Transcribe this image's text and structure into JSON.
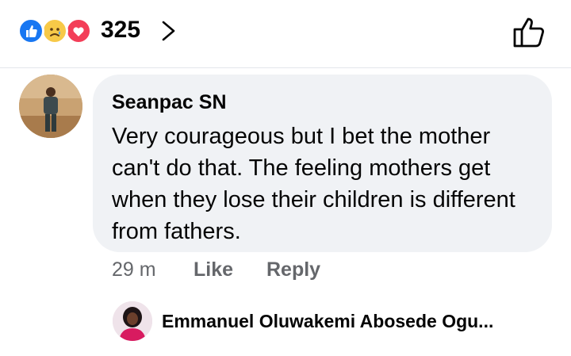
{
  "reactions": {
    "count": "325",
    "icons": [
      "like-icon",
      "sad-icon",
      "love-icon"
    ]
  },
  "comment": {
    "author": "Seanpac SN",
    "text": "Very courageous but I bet the mother can't do that. The feeling mothers get when they lose their children is different from fathers.",
    "time": "29 m",
    "like_label": "Like",
    "reply_label": "Reply"
  },
  "reply_preview": {
    "author": "Emmanuel Oluwakemi Abosede Ogu..."
  },
  "colors": {
    "like_blue": "#1877f2",
    "love_red": "#f33e58",
    "sad_yellow": "#f7c948",
    "bubble_bg": "#f0f2f5",
    "secondary_text": "#65676b"
  }
}
